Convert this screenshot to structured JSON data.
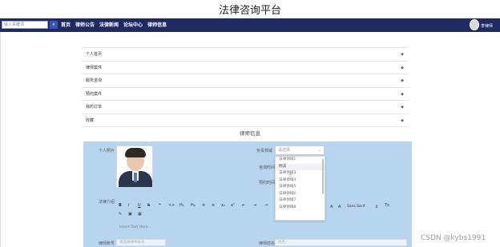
{
  "app": {
    "title": "法律咨询平台"
  },
  "search": {
    "placeholder": "输入关键词",
    "button_icon": "search-icon"
  },
  "nav": {
    "items": [
      "首页",
      "律师公告",
      "法律新闻",
      "论坛中心",
      "律师信息"
    ]
  },
  "user": {
    "name": "李律师"
  },
  "menu": {
    "items": [
      "个人首页",
      "律师案件",
      "服务咨询",
      "预约案件",
      "我的订单",
      "收藏"
    ],
    "chevron_icon": "chevron-right-icon"
  },
  "section": {
    "title": "律师信息"
  },
  "form": {
    "photo_label": "个人照片",
    "domain_label": "负责领域",
    "domain_placeholder": "请选择",
    "time_label_1": "咨询时间",
    "time_label_2": "预约时间",
    "intro_label": "法律介绍",
    "editor_placeholder": "Insert Text Here...",
    "bottom_left_label": "律师账号",
    "bottom_left_placeholder": "请选择律师账号",
    "bottom_right_label": "律师姓名",
    "bottom_right_placeholder": "姓名",
    "toolbar": [
      "B",
      "I",
      "U",
      "S",
      "❝",
      "<>",
      "H₁",
      "H₂",
      "≡",
      "≡",
      "x₂",
      "x²",
      "⇤",
      "⇥",
      "→",
      "A",
      "A",
      "Sans Serif",
      "⇕",
      "Tx"
    ],
    "toolbar_row2": [
      "✎",
      "▣",
      "▦"
    ]
  },
  "dropdown": {
    "options": [
      "法律领域1",
      "刑法",
      "法律领域3",
      "法律领域4",
      "法律领域5",
      "法律领域6",
      "法律领域7",
      "法律领域8"
    ],
    "hovered_index": 1
  },
  "watermark": {
    "text": "CSDN @kybs1991"
  },
  "colors": {
    "topbar": "#1f2a63",
    "form_bg": "#b7d5ef",
    "accent": "#3a56b8"
  }
}
